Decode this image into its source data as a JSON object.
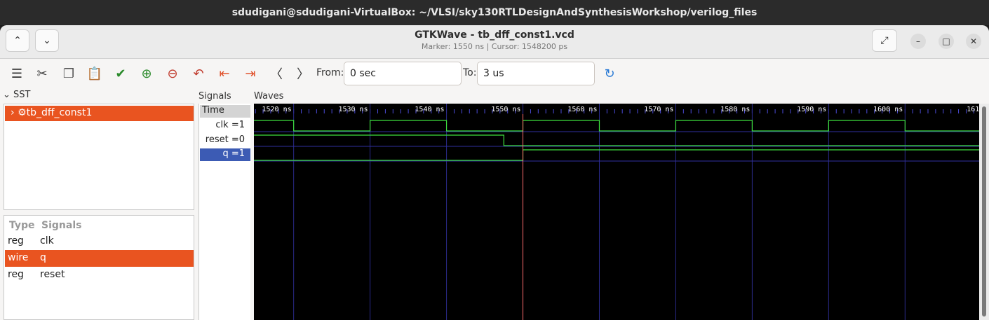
{
  "os_title": "sdudigani@sdudigani-VirtualBox: ~/VLSI/sky130RTLDesignAndSynthesisWorkshop/verilog_files",
  "window": {
    "title": "GTKWave - tb_dff_const1.vcd",
    "subtitle": "Marker: 1550 ns  |  Cursor: 1548200 ps"
  },
  "toolbar": {
    "icons": [
      "menu-icon",
      "cut-icon",
      "copy-icon",
      "paste-icon",
      "select-all-icon",
      "zoom-in-icon",
      "zoom-out-icon",
      "undo-zoom-icon",
      "zoom-to-start-icon",
      "zoom-to-end-icon",
      "prev-edge-icon",
      "next-edge-icon"
    ],
    "from_label": "From:",
    "from_value": "0 sec",
    "to_label": "To:",
    "to_value": "3 us",
    "reload_icon": "reload-icon"
  },
  "sst": {
    "label": "SST",
    "tree_item": "tb_dff_const1"
  },
  "signal_list": {
    "headers": [
      "Type",
      "Signals"
    ],
    "rows": [
      {
        "type": "reg",
        "name": "clk",
        "selected": false
      },
      {
        "type": "wire",
        "name": "q",
        "selected": true
      },
      {
        "type": "reg",
        "name": "reset",
        "selected": false
      }
    ]
  },
  "signals_pane": {
    "label": "Signals",
    "time_label": "Time",
    "rows": [
      {
        "text": "clk =1",
        "selected": false
      },
      {
        "text": "reset =0",
        "selected": false
      },
      {
        "text": "q =1",
        "selected": true
      }
    ]
  },
  "waves": {
    "label": "Waves",
    "marker_ns": 1550,
    "view_start_ns": 1514.8,
    "view_end_ns": 1609.7,
    "tick_labels": [
      "1520 ns",
      "1530 ns",
      "1540 ns",
      "1550 ns",
      "1560 ns",
      "1570 ns",
      "1580 ns",
      "1590 ns",
      "1600 ns",
      "161"
    ],
    "tick_values_ns": [
      1520,
      1530,
      1540,
      1550,
      1560,
      1570,
      1580,
      1590,
      1600,
      1610
    ],
    "clk_edges_ns": [
      1520,
      1530,
      1540,
      1550,
      1560,
      1570,
      1580,
      1590,
      1600
    ],
    "clk_initial": 1,
    "reset_fall_ns": 1547.5,
    "q_rise_ns": 1550
  }
}
